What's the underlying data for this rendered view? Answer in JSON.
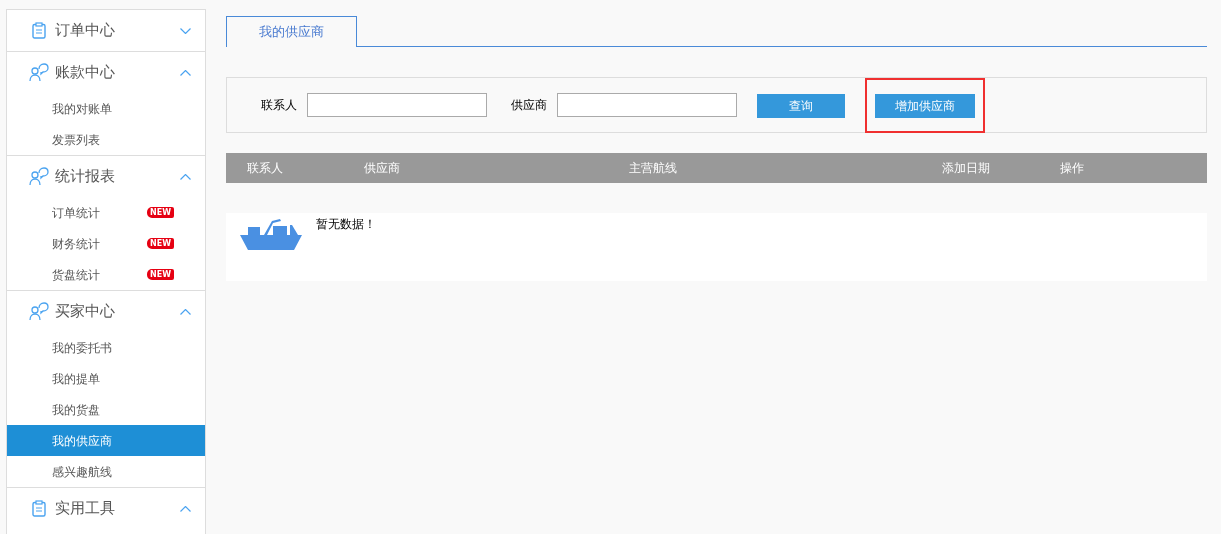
{
  "sidebar": {
    "sections": [
      {
        "title": "订单中心",
        "kind": "clipboard",
        "expanded": false
      },
      {
        "title": "账款中心",
        "kind": "person",
        "expanded": true,
        "items": [
          {
            "label": "我的对账单",
            "selected": false
          },
          {
            "label": "发票列表",
            "selected": false
          }
        ]
      },
      {
        "title": "统计报表",
        "kind": "person",
        "expanded": true,
        "items": [
          {
            "label": "订单统计",
            "selected": false,
            "badge": "NEW"
          },
          {
            "label": "财务统计",
            "selected": false,
            "badge": "NEW"
          },
          {
            "label": "货盘统计",
            "selected": false,
            "badge": "NEW"
          }
        ]
      },
      {
        "title": "买家中心",
        "kind": "person",
        "expanded": true,
        "items": [
          {
            "label": "我的委托书",
            "selected": false
          },
          {
            "label": "我的提单",
            "selected": false
          },
          {
            "label": "我的货盘",
            "selected": false
          },
          {
            "label": "我的供应商",
            "selected": true
          },
          {
            "label": "感兴趣航线",
            "selected": false
          }
        ]
      },
      {
        "title": "实用工具",
        "kind": "clipboard",
        "expanded": true
      }
    ]
  },
  "tabs": [
    {
      "label": "我的供应商",
      "selected": true
    }
  ],
  "filters": [
    {
      "label": "联系人"
    },
    {
      "label": "供应商"
    }
  ],
  "buttons": [
    {
      "label": "查询",
      "highlighted": false
    },
    {
      "label": "增加供应商",
      "highlighted": true
    }
  ],
  "table": {
    "columns": [
      "联系人",
      "供应商",
      "主营航线",
      "添加日期",
      "操作"
    ],
    "empty_message": "暂无数据！"
  }
}
